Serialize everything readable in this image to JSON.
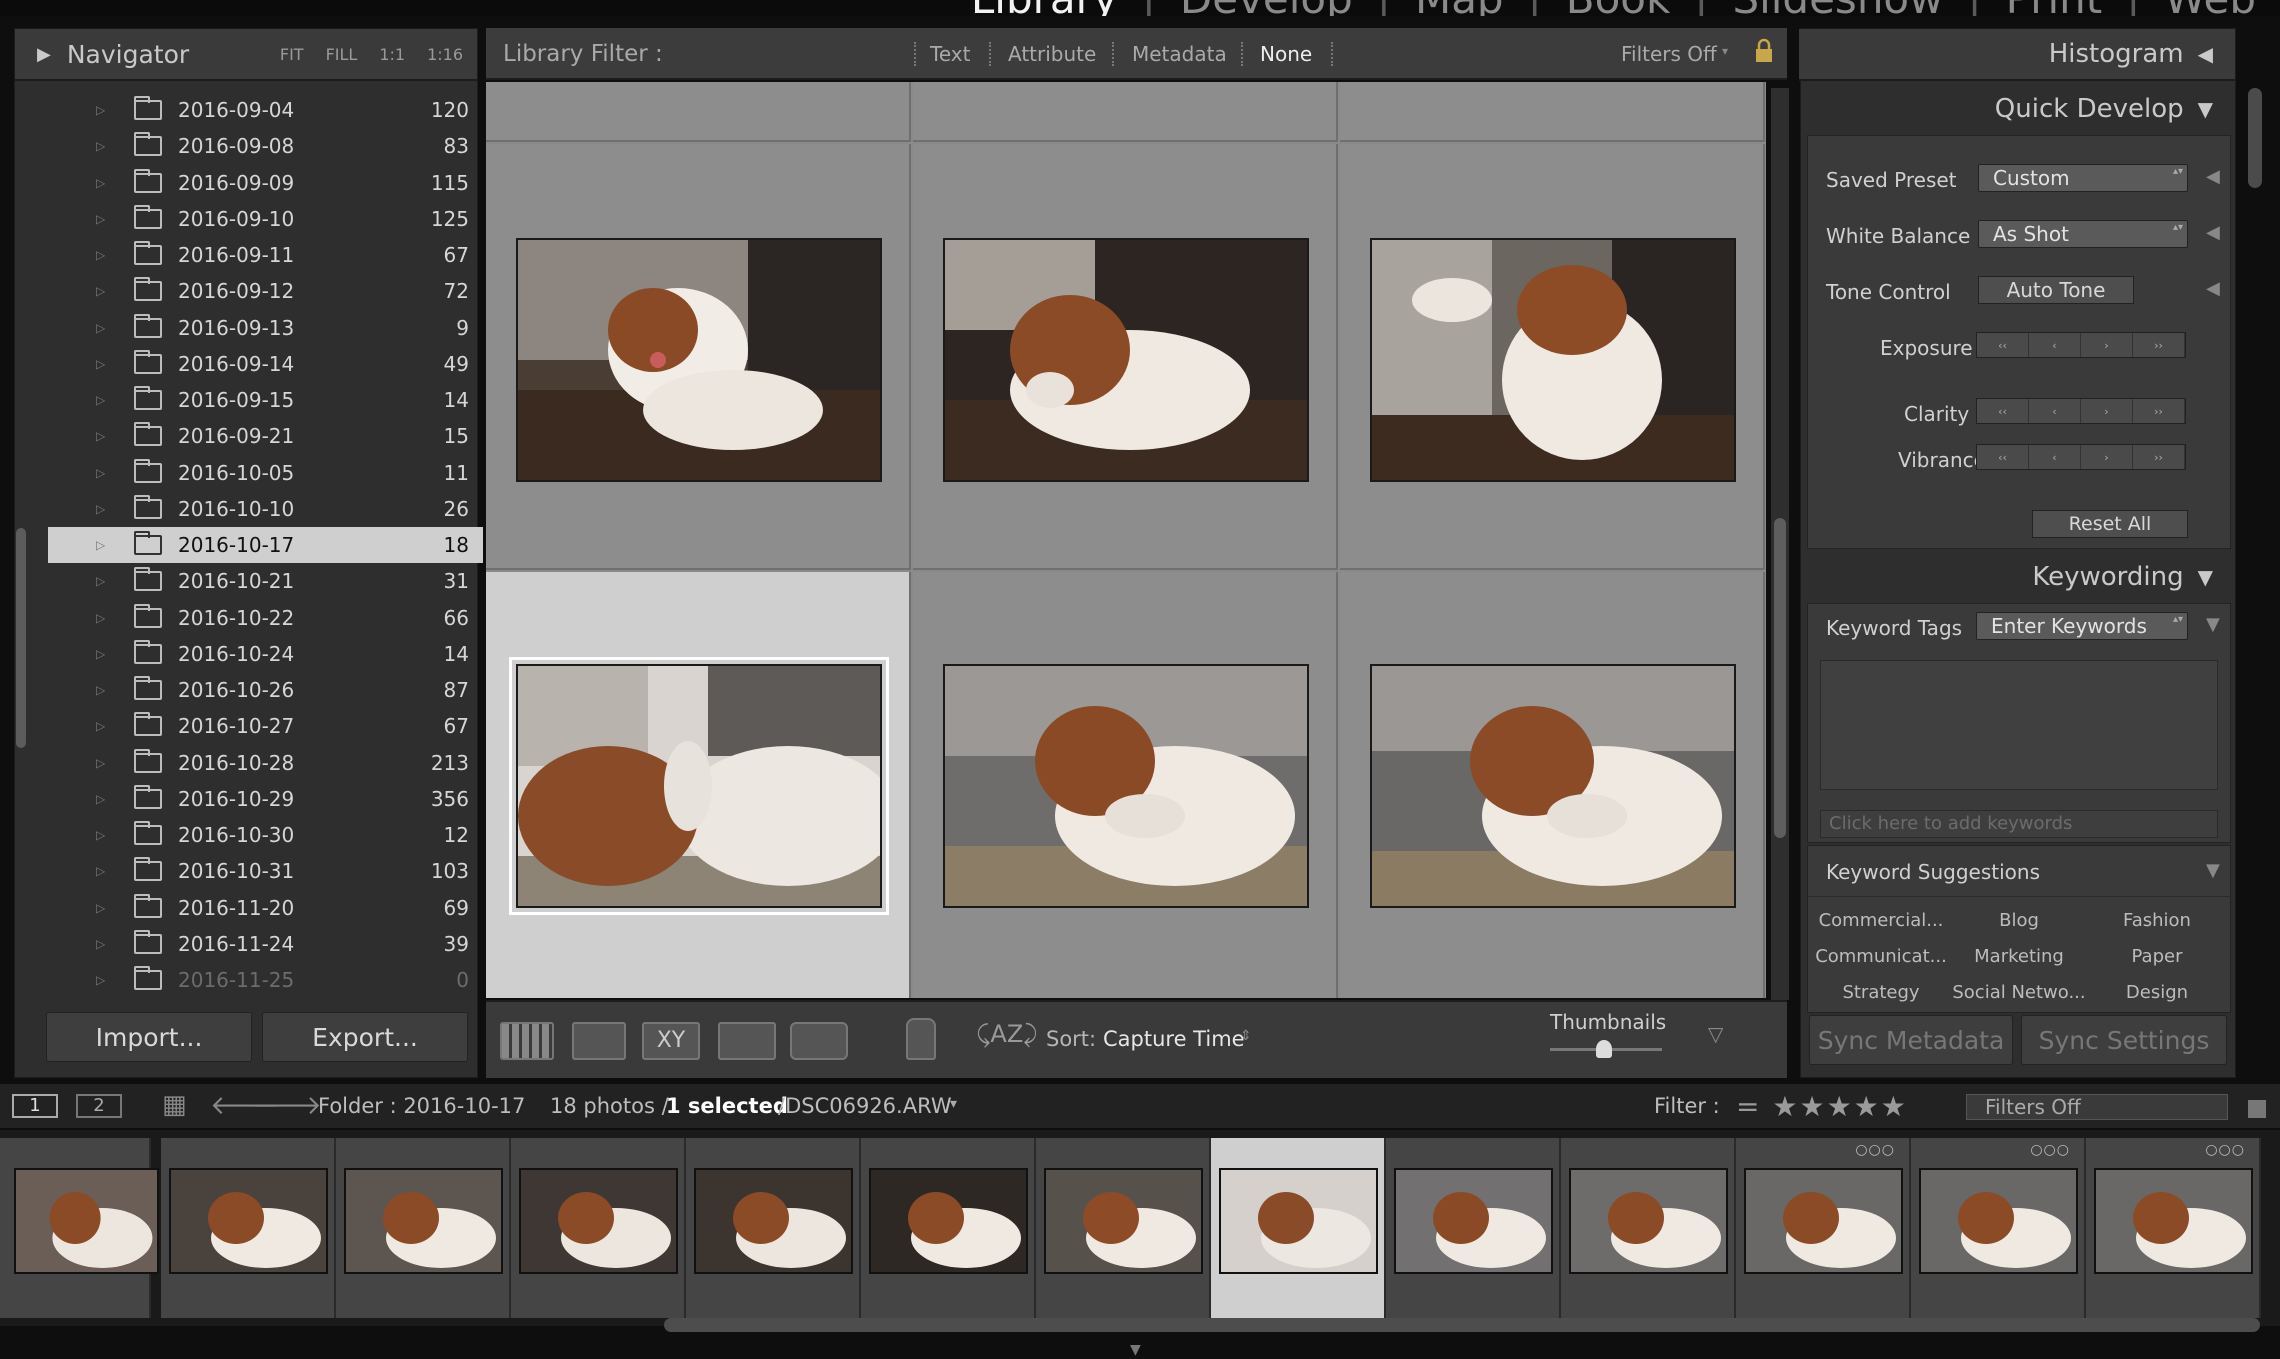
{
  "modules": [
    "Library",
    "Develop",
    "Map",
    "Book",
    "Slideshow",
    "Print",
    "Web"
  ],
  "active_module": "Library",
  "navigator": {
    "title": "Navigator",
    "zoom_options": [
      "FIT",
      "FILL",
      "1:1",
      "1:16"
    ]
  },
  "folders": [
    {
      "name": "2016-09-04",
      "count": "120"
    },
    {
      "name": "2016-09-08",
      "count": "83"
    },
    {
      "name": "2016-09-09",
      "count": "115"
    },
    {
      "name": "2016-09-10",
      "count": "125"
    },
    {
      "name": "2016-09-11",
      "count": "67"
    },
    {
      "name": "2016-09-12",
      "count": "72"
    },
    {
      "name": "2016-09-13",
      "count": "9"
    },
    {
      "name": "2016-09-14",
      "count": "49"
    },
    {
      "name": "2016-09-15",
      "count": "14"
    },
    {
      "name": "2016-09-21",
      "count": "15"
    },
    {
      "name": "2016-10-05",
      "count": "11"
    },
    {
      "name": "2016-10-10",
      "count": "26"
    },
    {
      "name": "2016-10-17",
      "count": "18"
    },
    {
      "name": "2016-10-21",
      "count": "31"
    },
    {
      "name": "2016-10-22",
      "count": "66"
    },
    {
      "name": "2016-10-24",
      "count": "14"
    },
    {
      "name": "2016-10-26",
      "count": "87"
    },
    {
      "name": "2016-10-27",
      "count": "67"
    },
    {
      "name": "2016-10-28",
      "count": "213"
    },
    {
      "name": "2016-10-29",
      "count": "356"
    },
    {
      "name": "2016-10-30",
      "count": "12"
    },
    {
      "name": "2016-10-31",
      "count": "103"
    },
    {
      "name": "2016-11-20",
      "count": "69"
    },
    {
      "name": "2016-11-24",
      "count": "39"
    },
    {
      "name": "2016-11-25",
      "count": "0"
    }
  ],
  "selected_folder_index": 12,
  "left_buttons": {
    "import": "Import...",
    "export": "Export..."
  },
  "library_filter": {
    "label": "Library Filter :",
    "tabs": [
      "Text",
      "Attribute",
      "Metadata",
      "None"
    ],
    "active": "None",
    "status": "Filters Off"
  },
  "toolbar": {
    "sort_label": "Sort:",
    "sort_value": "Capture Time",
    "thumbnails_label": "Thumbnails",
    "thumbnail_size": 0.48
  },
  "right": {
    "histogram": "Histogram",
    "quick_develop": {
      "title": "Quick Develop",
      "saved_preset_label": "Saved Preset",
      "saved_preset_value": "Custom",
      "white_balance_label": "White Balance",
      "white_balance_value": "As Shot",
      "tone_control_label": "Tone Control",
      "auto_tone": "Auto Tone",
      "exposure": "Exposure",
      "clarity": "Clarity",
      "vibrance": "Vibrance",
      "reset": "Reset All"
    },
    "keywording": {
      "title": "Keywording",
      "tags_label": "Keyword Tags",
      "tags_value": "Enter Keywords",
      "placeholder": "Click here to add keywords",
      "suggestions_title": "Keyword Suggestions",
      "suggestions": [
        "Commercial...",
        "Blog",
        "Fashion",
        "Communicat...",
        "Marketing",
        "Paper",
        "Strategy",
        "Social Netwo...",
        "Design"
      ]
    },
    "sync_metadata": "Sync Metadata",
    "sync_settings": "Sync Settings"
  },
  "filter_bar": {
    "page1": "1",
    "page2": "2",
    "folder": "Folder : 2016-10-17",
    "photos": "18 photos /",
    "selected": "1 selected",
    "file": "/DSC06926.ARW",
    "filter_label": "Filter :",
    "filter_value": "Filters Off"
  },
  "colors": {
    "accent_selected": "#cfcfcf",
    "panel": "#2e2e2e",
    "grid": "#8a8a8a"
  }
}
